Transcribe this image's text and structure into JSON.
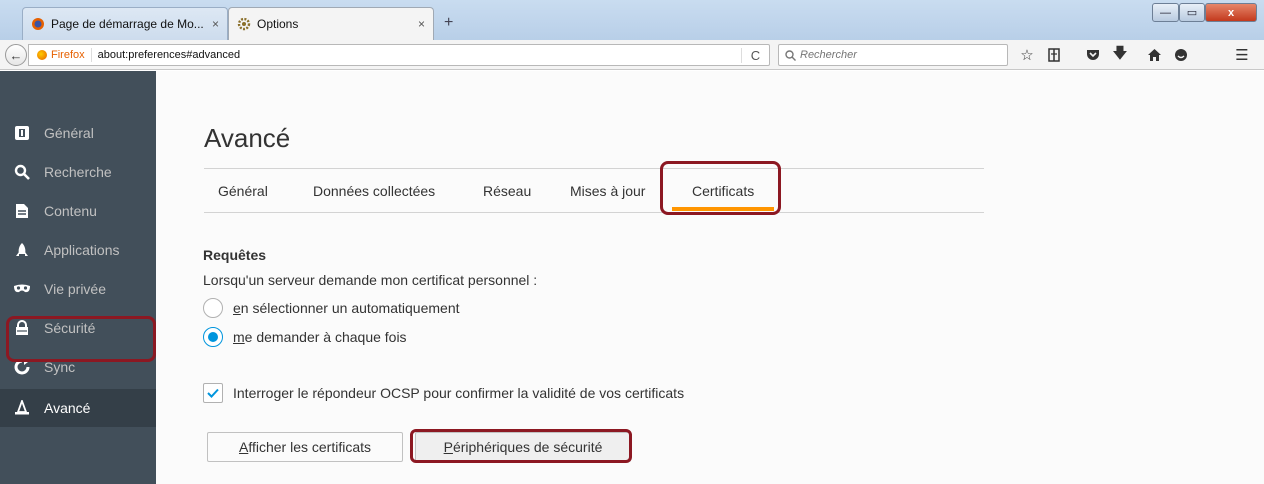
{
  "browser": {
    "tabs": [
      {
        "label": "Page de démarrage de Mo...",
        "close": "×"
      },
      {
        "label": "Options",
        "close": "×"
      }
    ],
    "new_tab": "+",
    "window_controls": {
      "minimize": "—",
      "maximize": "▭",
      "close": "x"
    },
    "identity_label": "Firefox",
    "url": "about:preferences#advanced",
    "reload": "C",
    "search_placeholder": "Rechercher"
  },
  "sidebar": {
    "items": [
      {
        "label": "Général",
        "icon": "general-icon"
      },
      {
        "label": "Recherche",
        "icon": "search-icon"
      },
      {
        "label": "Contenu",
        "icon": "content-icon"
      },
      {
        "label": "Applications",
        "icon": "applications-icon"
      },
      {
        "label": "Vie privée",
        "icon": "privacy-mask-icon"
      },
      {
        "label": "Sécurité",
        "icon": "security-lock-icon"
      },
      {
        "label": "Sync",
        "icon": "sync-icon"
      },
      {
        "label": "Avancé",
        "icon": "advanced-wizard-hat-icon"
      }
    ],
    "selected": "Avancé"
  },
  "main": {
    "title": "Avancé",
    "tabs": [
      {
        "label": "Général"
      },
      {
        "label": "Données collectées"
      },
      {
        "label": "Réseau"
      },
      {
        "label": "Mises à jour"
      },
      {
        "label": "Certificats"
      }
    ],
    "active_tab": "Certificats",
    "requests": {
      "heading": "Requêtes",
      "description": "Lorsqu'un serveur demande mon certificat personnel :",
      "option_auto_accesskey": "e",
      "option_auto_rest": "n sélectionner un automatiquement",
      "option_ask_accesskey": "m",
      "option_ask_rest": "e demander à chaque fois",
      "selected_option": "ask"
    },
    "ocsp": {
      "label": "Interroger le répondeur OCSP pour confirmer la validité de vos certificats",
      "checked": true
    },
    "buttons": {
      "view_accesskey": "A",
      "view_rest": "fficher les certificats",
      "devices_accesskey": "P",
      "devices_rest": "ériphériques de sécurité"
    }
  },
  "colors": {
    "sidebar_bg": "#424f5a",
    "accent": "#0095dd",
    "active_tab_underline": "#ff9500",
    "highlight_box": "#8c1822"
  }
}
